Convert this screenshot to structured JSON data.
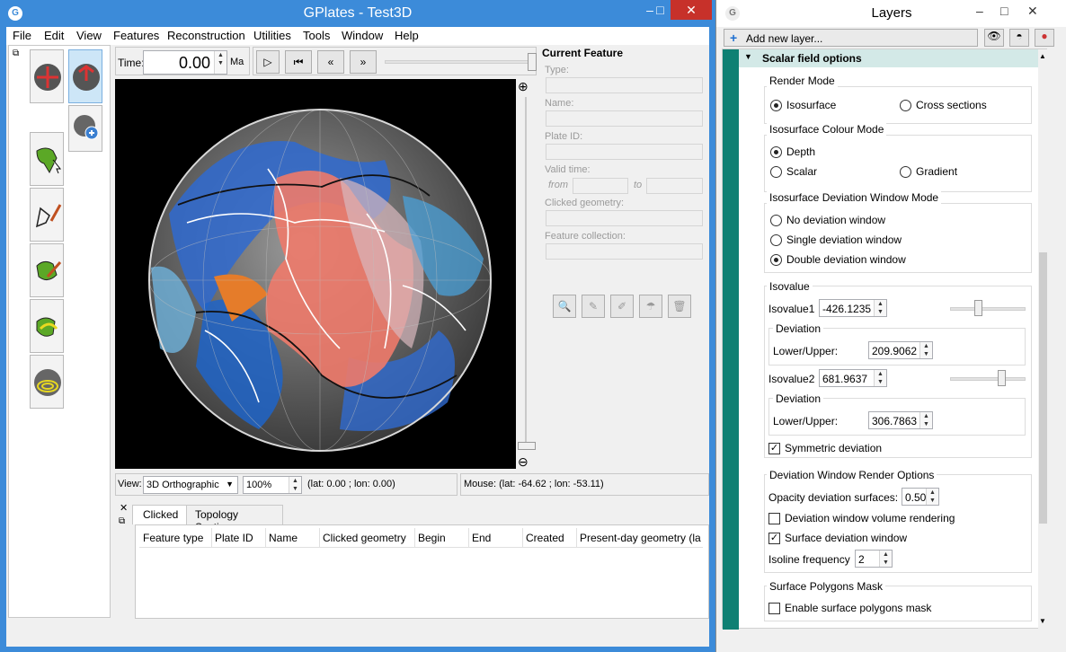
{
  "main_window": {
    "title": "GPlates - Test3D",
    "icon": "globe-logo-icon",
    "controls": {
      "minimize": "–",
      "maximize": "□",
      "close": "✕"
    }
  },
  "menubar": [
    "File",
    "Edit",
    "View",
    "Features",
    "Reconstruction",
    "Utilities",
    "Tools",
    "Window",
    "Help"
  ],
  "toolbar": {
    "time_label": "Time:",
    "time_value": "0.00",
    "time_unit": "Ma",
    "tools": [
      "drag-globe-icon",
      "zoom-globe-icon",
      "choose-feature-icon",
      "digitise-geometry-icon",
      "edit-geometry-icon",
      "topology-icon",
      "small-circle-icon"
    ]
  },
  "current_feature": {
    "heading": "Current Feature",
    "type_label": "Type:",
    "name_label": "Name:",
    "plate_id_label": "Plate ID:",
    "valid_time_label": "Valid time:",
    "from_label": "from",
    "to_label": "to",
    "clicked_geometry_label": "Clicked geometry:",
    "feature_collection_label": "Feature collection:"
  },
  "view_bar": {
    "view_label": "View:",
    "projection": "3D Orthographic",
    "zoom": "100%",
    "camera": "(lat: 0.00 ; lon: 0.00)",
    "mouse": "Mouse: (lat: -64.62 ; lon: -53.11)"
  },
  "bottom_tabs": {
    "tabs": [
      "Clicked",
      "Topology Sections"
    ],
    "columns": [
      "Feature type",
      "Plate ID",
      "Name",
      "Clicked geometry",
      "Begin",
      "End",
      "Created",
      "Present-day geometry (la"
    ]
  },
  "layers": {
    "title": "Layers",
    "add_new_layer": "Add new layer...",
    "section_title": "Scalar field options",
    "render_mode": {
      "title": "Render Mode",
      "options": [
        "Isosurface",
        "Cross sections"
      ],
      "selected": "Isosurface"
    },
    "colour_mode": {
      "title": "Isosurface Colour Mode",
      "options": [
        "Depth",
        "Scalar",
        "Gradient"
      ],
      "selected": "Depth"
    },
    "deviation_mode": {
      "title": "Isosurface Deviation Window Mode",
      "options": [
        "No deviation window",
        "Single deviation window",
        "Double deviation window"
      ],
      "selected": "Double deviation window"
    },
    "isovalue": {
      "title": "Isovalue",
      "iso1_label": "Isovalue1",
      "iso1_value": "-426.1235",
      "iso1_slider": 0.37,
      "deviation_label": "Deviation",
      "lower_upper_label": "Lower/Upper:",
      "deviation1_value": "209.9062",
      "iso2_label": "Isovalue2",
      "iso2_value": "681.9637",
      "iso2_slider": 0.68,
      "deviation2_value": "306.7863",
      "symmetric_label": "Symmetric deviation",
      "symmetric_checked": true
    },
    "render_options": {
      "title": "Deviation Window Render Options",
      "opacity_label": "Opacity deviation surfaces:",
      "opacity_value": "0.50",
      "volume_label": "Deviation window volume rendering",
      "volume_checked": false,
      "surface_label": "Surface deviation window",
      "surface_checked": true,
      "isoline_label": "Isoline frequency",
      "isoline_value": "2"
    },
    "mask": {
      "title": "Surface Polygons Mask",
      "enable_label": "Enable surface polygons mask",
      "enable_checked": false
    }
  },
  "colors": {
    "titlebar": "#3c8bd9",
    "close": "#c7312a",
    "layer_accent": "#0f8073",
    "section_bg": "#d3e9e7"
  }
}
